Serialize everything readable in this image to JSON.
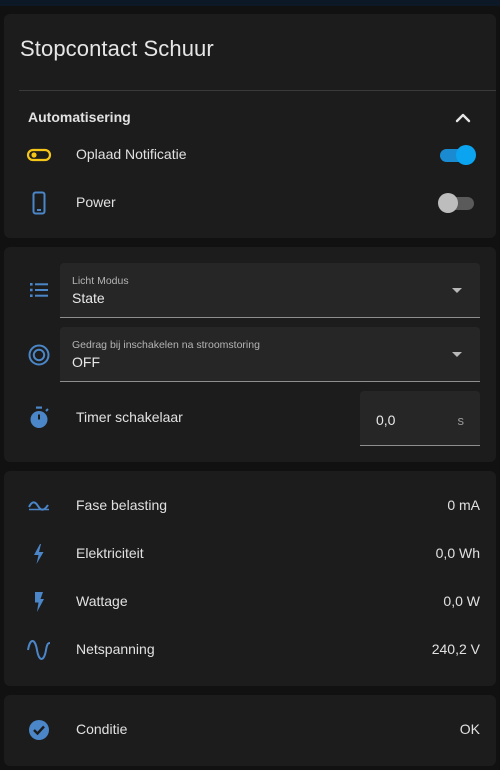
{
  "header": {
    "title": "Stopcontact Schuur"
  },
  "automation": {
    "title": "Automatisering",
    "items": [
      {
        "label": "Oplaad Notificatie",
        "icon": "toggle-switch-icon",
        "state": "on"
      },
      {
        "label": "Power",
        "icon": "phone-icon",
        "state": "off"
      }
    ]
  },
  "config": {
    "light_mode": {
      "label": "Licht Modus",
      "value": "State",
      "icon": "list-icon"
    },
    "power_on_behavior": {
      "label": "Gedrag bij inschakelen na stroomstoring",
      "value": "OFF",
      "icon": "target-icon"
    },
    "timer": {
      "label": "Timer schakelaar",
      "value": "0,0",
      "unit": "s",
      "icon": "timer-icon"
    }
  },
  "sensors": [
    {
      "label": "Fase belasting",
      "value": "0 mA",
      "icon": "current-ac-icon"
    },
    {
      "label": "Elektriciteit",
      "value": "0,0 Wh",
      "icon": "lightning-bolt-icon"
    },
    {
      "label": "Wattage",
      "value": "0,0 W",
      "icon": "flash-icon"
    },
    {
      "label": "Netspanning",
      "value": "240,2 V",
      "icon": "sine-wave-icon"
    }
  ],
  "status": {
    "label": "Conditie",
    "value": "OK",
    "icon": "check-circle-icon"
  },
  "colors": {
    "accent": "#0aa4f0",
    "icon_blue": "#4a86c8",
    "toggle_icon": "#f5c518",
    "card": "#1c1c1c",
    "background": "#111111"
  }
}
